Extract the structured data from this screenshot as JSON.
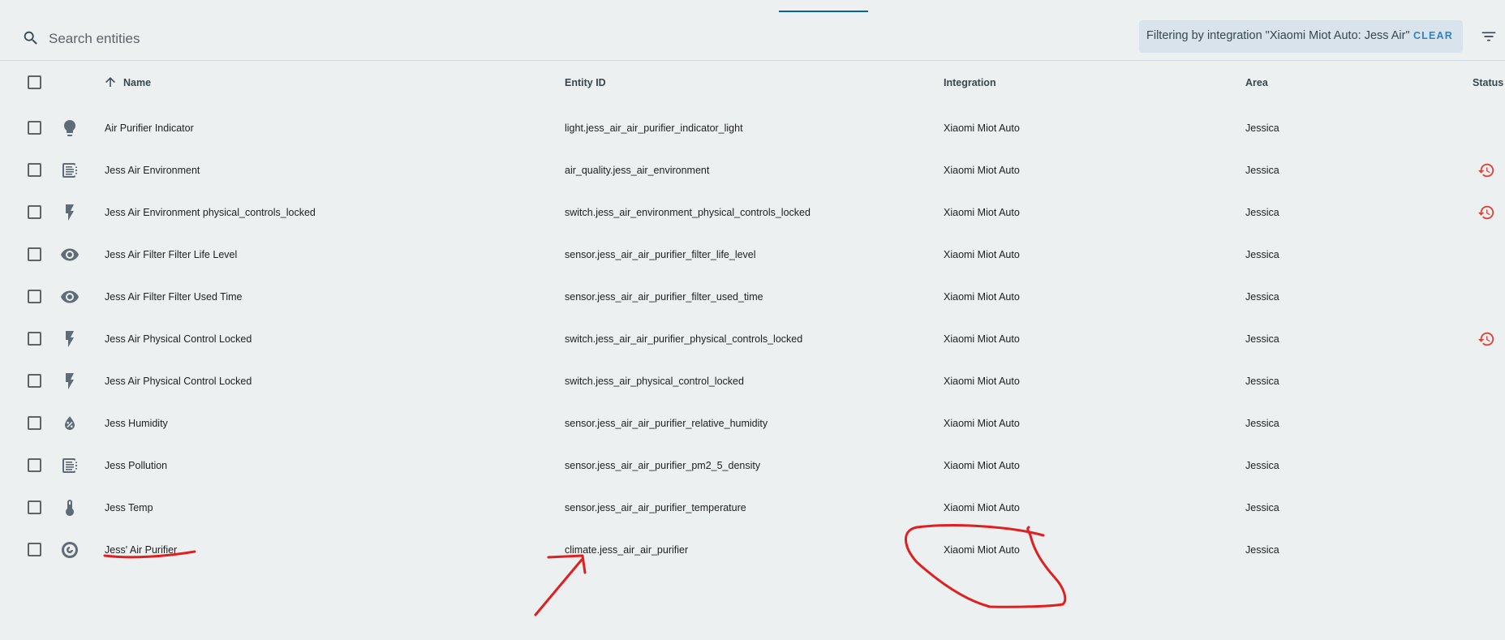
{
  "search": {
    "placeholder": "Search entities"
  },
  "filter": {
    "text": "Filtering by integration \"Xiaomi Miot Auto: Jess Air\"",
    "clear_label": "CLEAR"
  },
  "table": {
    "columns": {
      "name": "Name",
      "entity_id": "Entity ID",
      "integration": "Integration",
      "area": "Area",
      "status": "Status"
    },
    "rows": [
      {
        "icon": "lightbulb-icon",
        "name": "Air Purifier Indicator",
        "entity_id": "light.jess_air_air_purifier_indicator_light",
        "integration": "Xiaomi Miot Auto",
        "area": "Jessica",
        "status": ""
      },
      {
        "icon": "air-filter-icon",
        "name": "Jess Air Environment",
        "entity_id": "air_quality.jess_air_environment",
        "integration": "Xiaomi Miot Auto",
        "area": "Jessica",
        "status": "restored"
      },
      {
        "icon": "flash-icon",
        "name": "Jess Air Environment physical_controls_locked",
        "entity_id": "switch.jess_air_environment_physical_controls_locked",
        "integration": "Xiaomi Miot Auto",
        "area": "Jessica",
        "status": "restored"
      },
      {
        "icon": "eye-icon",
        "name": "Jess Air Filter Filter Life Level",
        "entity_id": "sensor.jess_air_air_purifier_filter_life_level",
        "integration": "Xiaomi Miot Auto",
        "area": "Jessica",
        "status": ""
      },
      {
        "icon": "eye-icon",
        "name": "Jess Air Filter Filter Used Time",
        "entity_id": "sensor.jess_air_air_purifier_filter_used_time",
        "integration": "Xiaomi Miot Auto",
        "area": "Jessica",
        "status": ""
      },
      {
        "icon": "flash-icon",
        "name": "Jess Air Physical Control Locked",
        "entity_id": "switch.jess_air_air_purifier_physical_controls_locked",
        "integration": "Xiaomi Miot Auto",
        "area": "Jessica",
        "status": "restored"
      },
      {
        "icon": "flash-icon",
        "name": "Jess Air Physical Control Locked",
        "entity_id": "switch.jess_air_physical_control_locked",
        "integration": "Xiaomi Miot Auto",
        "area": "Jessica",
        "status": ""
      },
      {
        "icon": "water-percent-icon",
        "name": "Jess Humidity",
        "entity_id": "sensor.jess_air_air_purifier_relative_humidity",
        "integration": "Xiaomi Miot Auto",
        "area": "Jessica",
        "status": ""
      },
      {
        "icon": "air-filter-icon",
        "name": "Jess Pollution",
        "entity_id": "sensor.jess_air_air_purifier_pm2_5_density",
        "integration": "Xiaomi Miot Auto",
        "area": "Jessica",
        "status": ""
      },
      {
        "icon": "thermometer-icon",
        "name": "Jess Temp",
        "entity_id": "sensor.jess_air_air_purifier_temperature",
        "integration": "Xiaomi Miot Auto",
        "area": "Jessica",
        "status": ""
      },
      {
        "icon": "air-purifier-icon",
        "name": "Jess' Air Purifier",
        "entity_id": "climate.jess_air_air_purifier",
        "integration": "Xiaomi Miot Auto",
        "area": "Jessica",
        "status": ""
      }
    ]
  },
  "colors": {
    "accent": "#0b5ea8",
    "status_error": "#db4437",
    "annotation": "#e02020"
  }
}
